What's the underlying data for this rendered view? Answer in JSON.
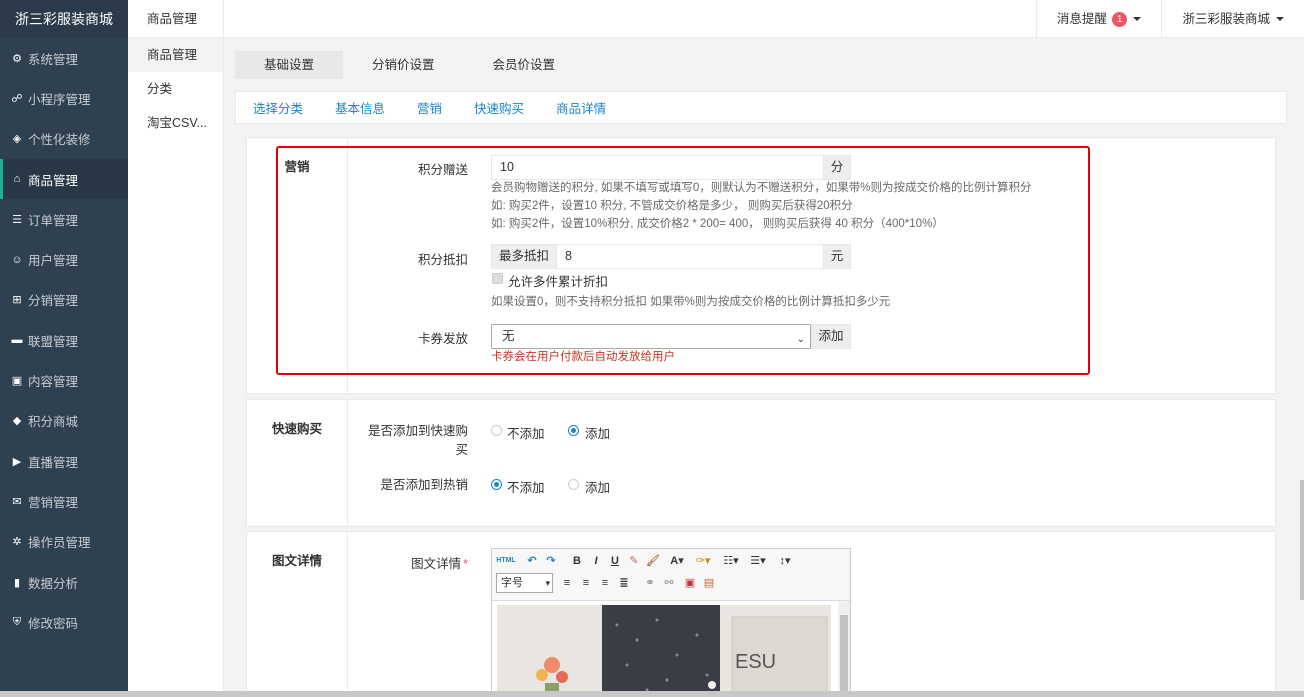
{
  "sidebar": {
    "brand": "浙三彩服装商城",
    "items": [
      {
        "label": "系统管理",
        "icon": "gear-icon",
        "glyph": "⚙"
      },
      {
        "label": "小程序管理",
        "icon": "link-icon",
        "glyph": "☍"
      },
      {
        "label": "个性化装修",
        "icon": "diamond-icon",
        "glyph": "◈"
      },
      {
        "label": "商品管理",
        "icon": "shop-icon",
        "glyph": "⌂"
      },
      {
        "label": "订单管理",
        "icon": "list-icon",
        "glyph": "☰"
      },
      {
        "label": "用户管理",
        "icon": "user-icon",
        "glyph": "☺"
      },
      {
        "label": "分销管理",
        "icon": "sitemap-icon",
        "glyph": "⊞"
      },
      {
        "label": "联盟管理",
        "icon": "wallet-icon",
        "glyph": "▬"
      },
      {
        "label": "内容管理",
        "icon": "content-icon",
        "glyph": "▣"
      },
      {
        "label": "积分商城",
        "icon": "cube-icon",
        "glyph": "◆"
      },
      {
        "label": "直播管理",
        "icon": "play-icon",
        "glyph": "▶"
      },
      {
        "label": "营销管理",
        "icon": "gift-icon",
        "glyph": "✉"
      },
      {
        "label": "操作员管理",
        "icon": "cog-icon",
        "glyph": "✲"
      },
      {
        "label": "数据分析",
        "icon": "bar-chart-icon",
        "glyph": "▮"
      },
      {
        "label": "修改密码",
        "icon": "shield-icon",
        "glyph": "⛨"
      }
    ]
  },
  "subnav": {
    "head": "商品管理",
    "items": [
      "商品管理",
      "分类",
      "淘宝CSV..."
    ]
  },
  "topbar": {
    "messages": "消息提醒",
    "message_count": "1",
    "shop": "浙三彩服装商城"
  },
  "tabs1": [
    "基础设置",
    "分销价设置",
    "会员价设置"
  ],
  "tabs2": [
    "选择分类",
    "基本信息",
    "营销",
    "快速购买",
    "商品详情"
  ],
  "marketing": {
    "title": "营销",
    "points_gift_label": "积分赠送",
    "points_gift_value": "10",
    "points_gift_unit": "分",
    "points_help_1": "会员购物赠送的积分, 如果不填写或填写0，则默认为不赠送积分，如果带%则为按成交价格的比例计算积分",
    "points_help_2": "如: 购买2件，设置10 积分, 不管成交价格是多少， 则购买后获得20积分",
    "points_help_3": "如: 购买2件，设置10%积分, 成交价格2 * 200= 400， 则购买后获得 40 积分（400*10%）",
    "deduct_label": "积分抵扣",
    "deduct_prefix": "最多抵扣",
    "deduct_value": "8",
    "deduct_unit": "元",
    "deduct_checkbox": "允许多件累计折扣",
    "deduct_help": "如果设置0，则不支持积分抵扣 如果带%则为按成交价格的比例计算抵扣多少元",
    "coupon_label": "卡券发放",
    "coupon_value": "无",
    "coupon_add": "添加",
    "coupon_help": "卡券会在用户付款后自动发放给用户"
  },
  "quickbuy": {
    "title": "快速购买",
    "q1_label_a": "是否添加到快速购",
    "q1_label_b": "买",
    "q1_opt1": "不添加",
    "q1_opt2": "添加",
    "q1_selected": "添加",
    "q2_label": "是否添加到热销",
    "q2_opt1": "不添加",
    "q2_opt2": "添加",
    "q2_selected": "不添加"
  },
  "detail": {
    "title": "图文详情",
    "label": "图文详情",
    "font_select": "字号",
    "image_text": "ESU"
  },
  "colors": {
    "sidebar_bg": "#2f4050",
    "link": "#1c84c6",
    "highlight_border": "#e1000c",
    "badge": "#ed5565"
  }
}
